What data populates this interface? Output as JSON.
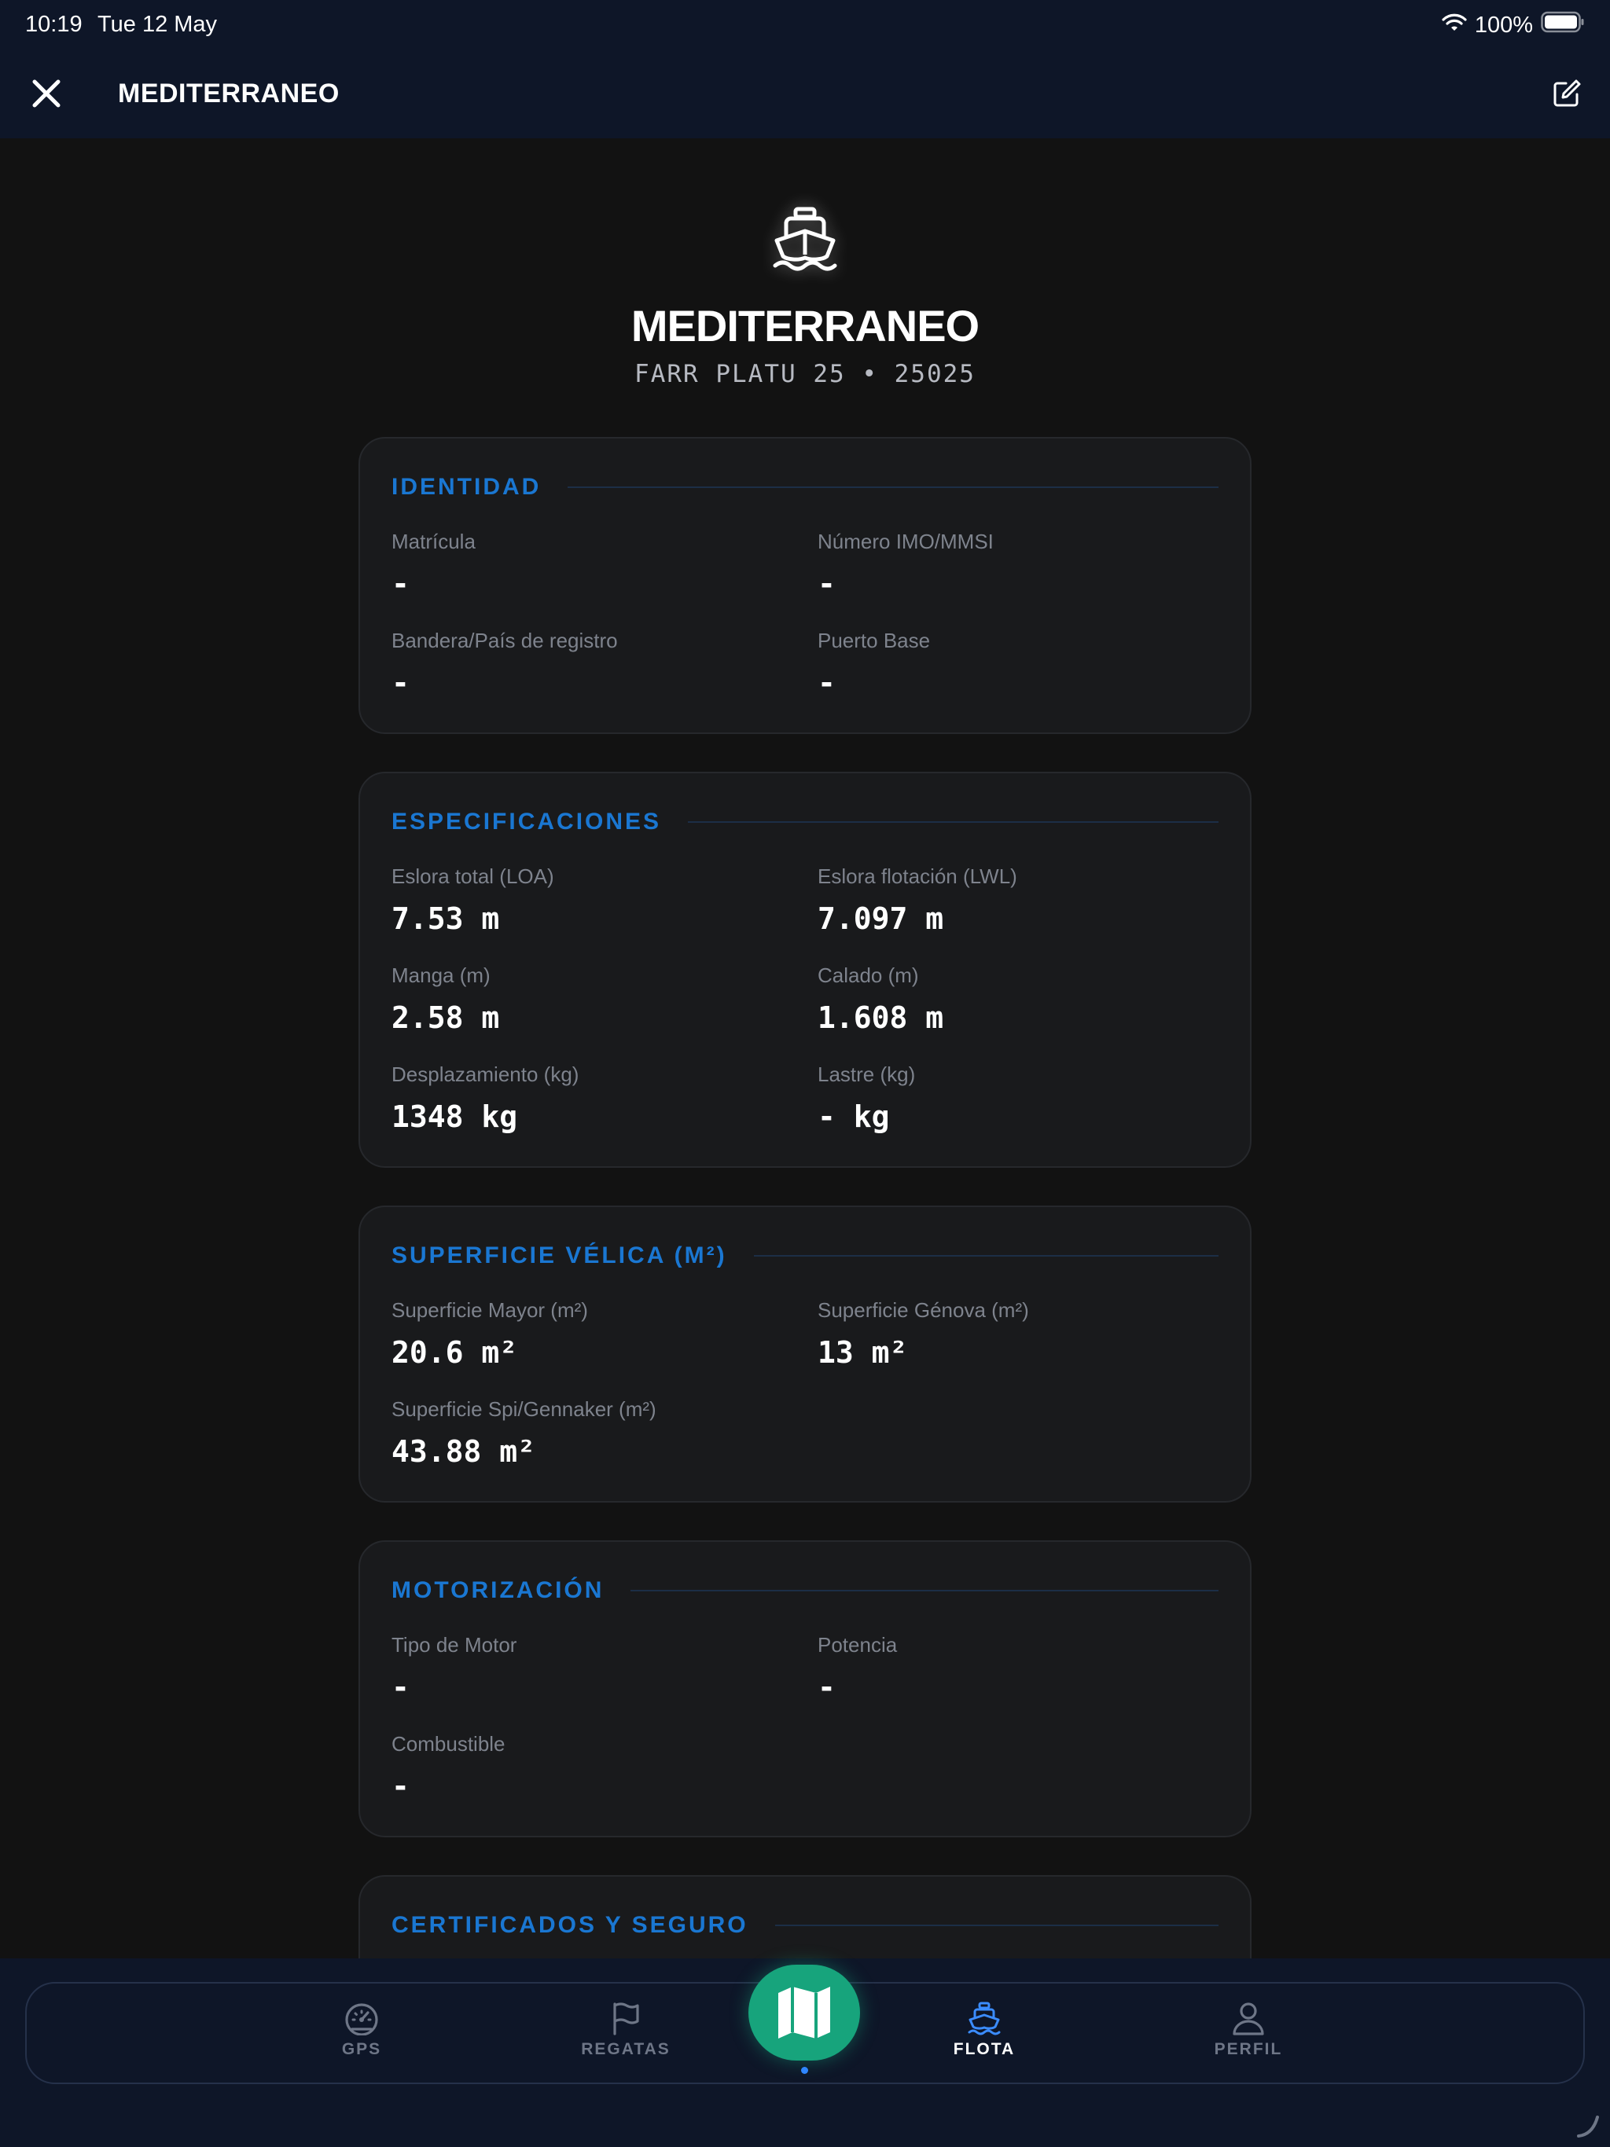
{
  "status_bar": {
    "time": "10:19",
    "date": "Tue 12 May",
    "battery": "100%"
  },
  "nav": {
    "title": "MEDITERRANEO",
    "close_icon": "close-icon",
    "edit_icon": "edit-icon"
  },
  "boat": {
    "icon": "ship-icon",
    "name": "MEDITERRANEO",
    "subtitle": "FARR PLATU 25 • 25025"
  },
  "sections": {
    "identidad": {
      "title": "IDENTIDAD",
      "fields": [
        {
          "label": "Matrícula",
          "value": "-"
        },
        {
          "label": "Número IMO/MMSI",
          "value": "-"
        },
        {
          "label": "Bandera/País de registro",
          "value": "-"
        },
        {
          "label": "Puerto Base",
          "value": "-"
        }
      ]
    },
    "especificaciones": {
      "title": "ESPECIFICACIONES",
      "fields": [
        {
          "label": "Eslora total (LOA)",
          "value": "7.53 m"
        },
        {
          "label": "Eslora flotación (LWL)",
          "value": "7.097 m"
        },
        {
          "label": "Manga (m)",
          "value": "2.58 m"
        },
        {
          "label": "Calado (m)",
          "value": "1.608 m"
        },
        {
          "label": "Desplazamiento (kg)",
          "value": "1348 kg"
        },
        {
          "label": "Lastre (kg)",
          "value": "- kg"
        }
      ]
    },
    "superficie": {
      "title": "SUPERFICIE VÉLICA (M²)",
      "fields": [
        {
          "label": "Superficie Mayor (m²)",
          "value": "20.6 m²"
        },
        {
          "label": "Superficie Génova (m²)",
          "value": "13 m²"
        },
        {
          "label": "Superficie Spi/Gennaker (m²)",
          "value": "43.88 m²"
        }
      ]
    },
    "motorizacion": {
      "title": "MOTORIZACIÓN",
      "fields": [
        {
          "label": "Tipo de Motor",
          "value": "-"
        },
        {
          "label": "Potencia",
          "value": "-"
        },
        {
          "label": "Combustible",
          "value": "-"
        }
      ]
    },
    "certificados": {
      "title": "CERTIFICADOS Y SEGURO"
    }
  },
  "tabbar": {
    "tabs": [
      {
        "label": "GPS",
        "icon": "gauge-icon",
        "active": false
      },
      {
        "label": "REGATAS",
        "icon": "flag-icon",
        "active": false
      },
      {
        "label": "FLOTA",
        "icon": "ship-icon",
        "active": true
      },
      {
        "label": "PERFIL",
        "icon": "user-icon",
        "active": false
      }
    ],
    "center_button_icon": "map-icon"
  },
  "colors": {
    "accent_blue": "#1a77d2",
    "fab_green": "#17a47c",
    "nav_bg": "#0e1628",
    "page_bg": "#121212",
    "card_bg": "#191a1c"
  }
}
